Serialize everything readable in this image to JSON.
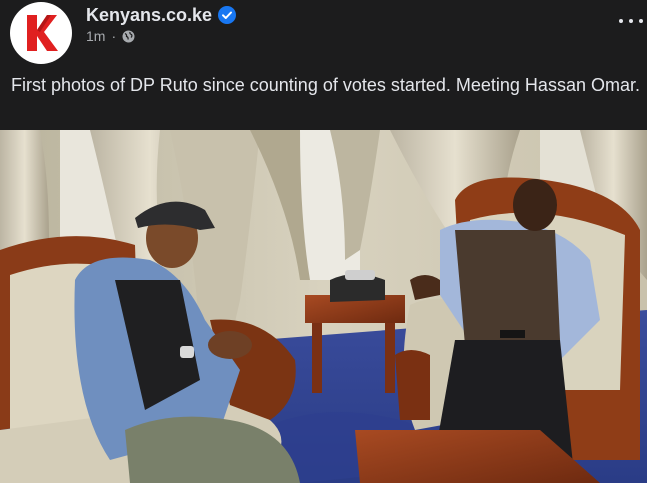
{
  "post": {
    "page_name": "Kenyans.co.ke",
    "verified_icon": "verified-badge-icon",
    "timestamp": "1m",
    "separator": "·",
    "audience_icon": "globe-icon",
    "more_icon": "more-options-icon",
    "caption": "First photos of DP Ruto since counting of votes started. Meeting Hassan Omar.",
    "avatar_logo": "K"
  },
  "colors": {
    "background": "#1c1c1d",
    "text_primary": "#e4e6eb",
    "text_secondary": "#a8abaf",
    "verified_blue": "#1877f2",
    "logo_red": "#e02020"
  }
}
